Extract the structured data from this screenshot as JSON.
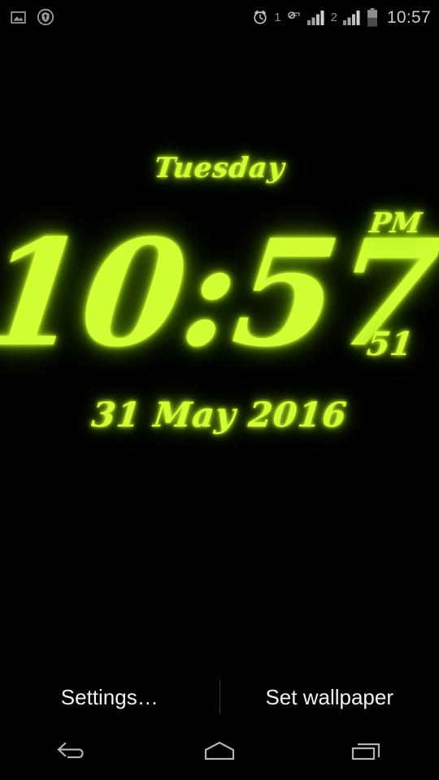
{
  "status_bar": {
    "left_icons": [
      {
        "name": "screenshot-image-icon",
        "glyph": "image"
      },
      {
        "name": "vpn-key-shield-icon",
        "glyph": "shield-key"
      }
    ],
    "alarm_icon": "alarm-clock-icon",
    "alarm_sim_label": "1",
    "silent_icon": "silent-mode-icon",
    "signal_sim1_icon": "signal-bars-icon",
    "sim2_label": "2",
    "signal_sim2_icon": "signal-bars-icon",
    "battery_icon": "battery-half-icon",
    "clock": "10:57"
  },
  "clock_widget": {
    "weekday": "Tuesday",
    "time": "10:57",
    "ampm": "PM",
    "seconds": "51",
    "date": "31 May 2016",
    "neon_color": "#d2ff33",
    "glow_color": "#9bd216",
    "background_color": "#000000"
  },
  "action_bar": {
    "settings_label": "Settings…",
    "set_wallpaper_label": "Set wallpaper"
  },
  "nav_bar": {
    "back": "back-icon",
    "home": "home-icon",
    "recents": "recents-icon"
  }
}
